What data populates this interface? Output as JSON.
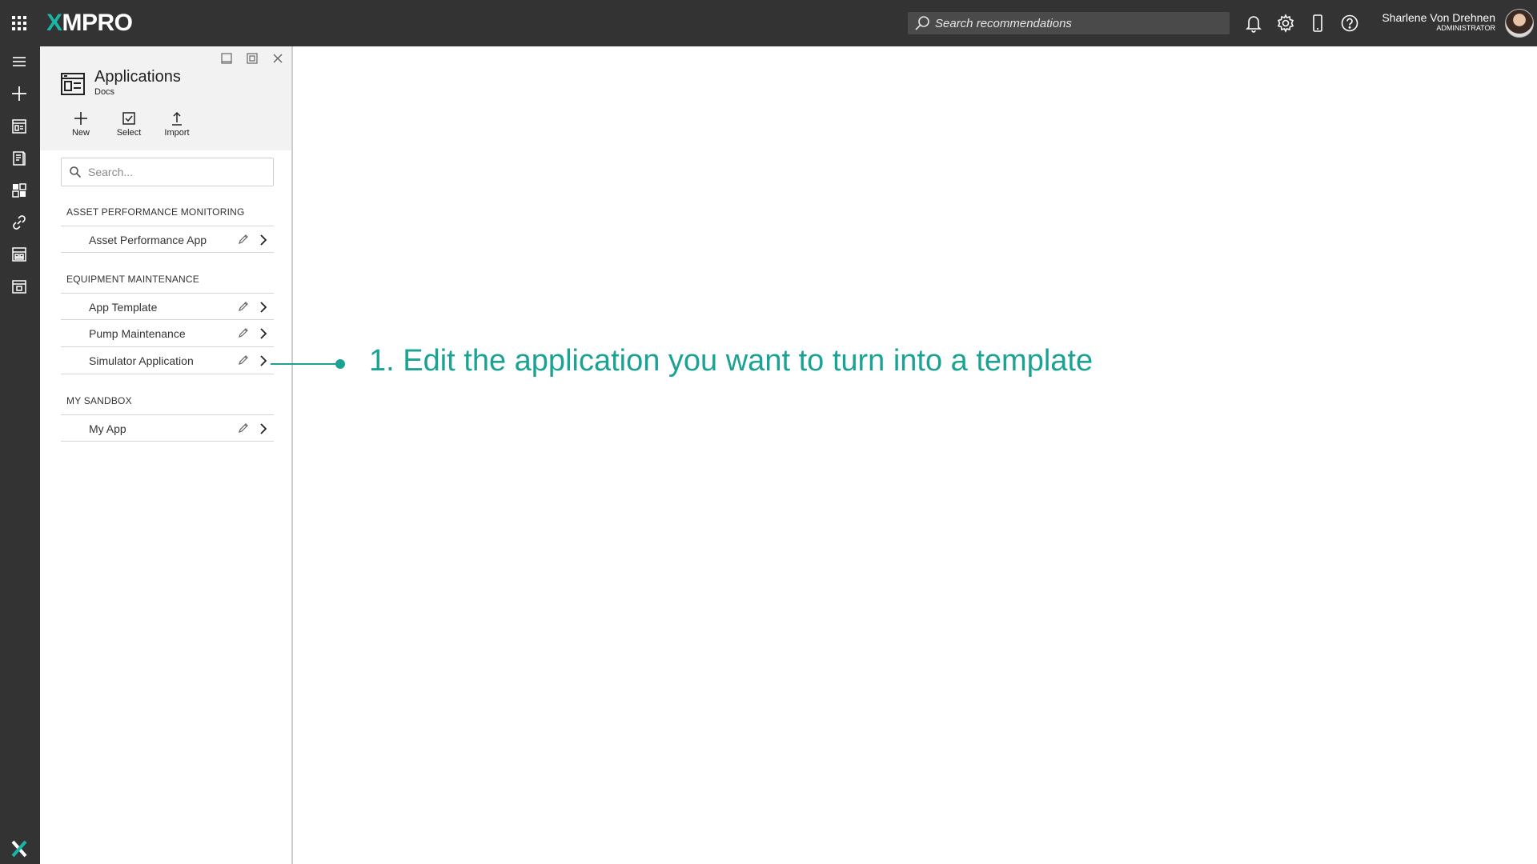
{
  "app": {
    "logo_x": "X",
    "logo_rest": "MPRO",
    "accent_color": "#1aa394"
  },
  "topbar": {
    "search_placeholder": "Search recommendations",
    "icons": [
      "apps-grid-icon",
      "search-icon",
      "bell-icon",
      "gear-icon",
      "mobile-icon",
      "help-icon"
    ],
    "user_name": "Sharlene Von Drehnen",
    "user_role": "ADMINISTRATOR"
  },
  "rail": {
    "icons": [
      "menu-icon",
      "plus-icon",
      "applications-icon",
      "recommendations-icon",
      "data-streams-icon",
      "link-icon",
      "dashboard-icon",
      "calendar-icon",
      "xmpro-logo-icon"
    ]
  },
  "panel": {
    "title": "Applications",
    "subtitle": "Docs",
    "toolbar": {
      "new_label": "New",
      "select_label": "Select",
      "import_label": "Import"
    },
    "search_placeholder": "Search...",
    "groups": [
      {
        "label": "ASSET PERFORMANCE MONITORING",
        "items": [
          {
            "label": "Asset Performance App"
          }
        ]
      },
      {
        "label": "EQUIPMENT MAINTENANCE",
        "items": [
          {
            "label": "App Template"
          },
          {
            "label": "Pump Maintenance"
          },
          {
            "label": "Simulator Application"
          }
        ]
      },
      {
        "label": "MY SANDBOX",
        "items": [
          {
            "label": "My App"
          }
        ]
      }
    ]
  },
  "annotation": {
    "text": "1. Edit the application you want to turn into a template"
  }
}
